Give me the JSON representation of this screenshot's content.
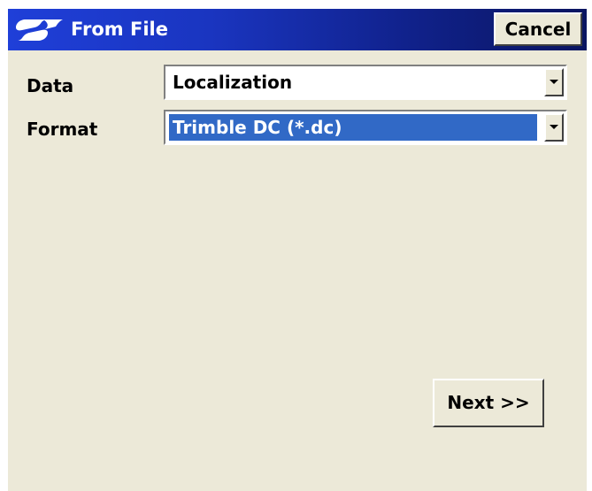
{
  "window": {
    "title": "From File",
    "cancel_label": "Cancel"
  },
  "form": {
    "data": {
      "label": "Data",
      "value": "Localization"
    },
    "format": {
      "label": "Format",
      "value": "Trimble DC (*.dc)"
    }
  },
  "actions": {
    "next_label": "Next >>"
  },
  "icons": {
    "logo": "trimble-logo-icon",
    "dropdown": "chevron-down-icon"
  },
  "colors": {
    "titlebar_start": "#1f3fd8",
    "titlebar_end": "#0a1560",
    "selection": "#3169c6",
    "window_bg": "#ece9d8"
  }
}
